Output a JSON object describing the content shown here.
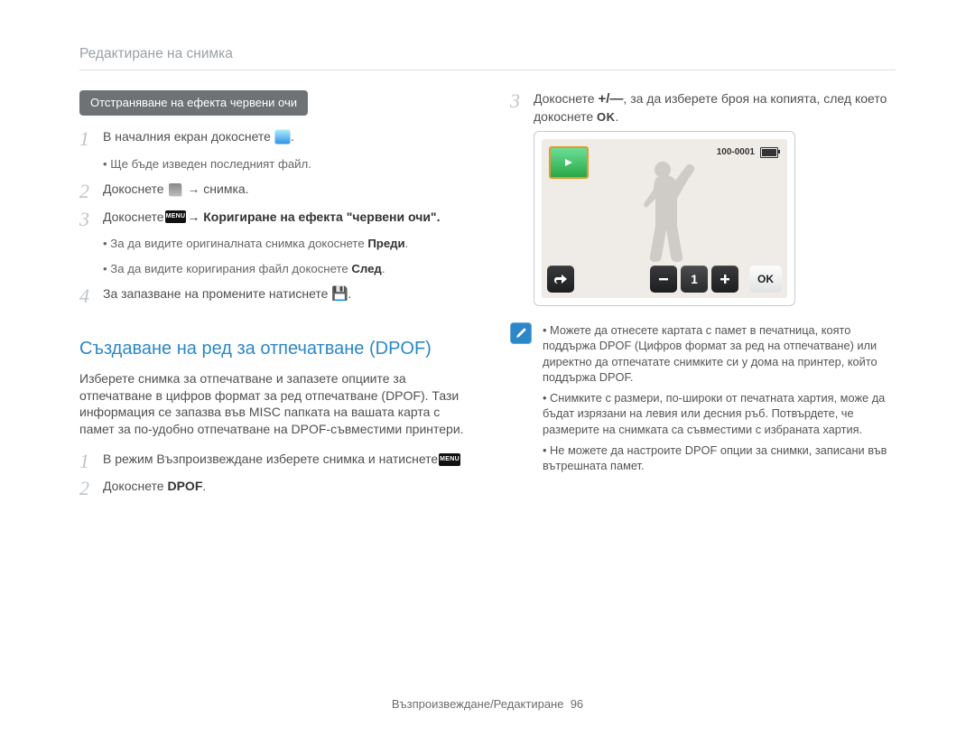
{
  "breadcrumb": "Редактиране на снимка",
  "left": {
    "pill": "Отстраняване на ефекта червени очи",
    "steps": [
      {
        "num": "1",
        "text": "В началния екран докоснете ",
        "trail_icon": "home-icon",
        "after": "."
      },
      {
        "num": "",
        "sub": "Ще бъде изведен последният файл."
      },
      {
        "num": "2",
        "text": "Докоснете ",
        "icon": "duplicate-icon",
        "after": " → снимка."
      },
      {
        "num": "3",
        "pre": "Докоснете ",
        "icon": "menu-icon",
        "after_strong": " → Коригиране на ефекта \"червени очи\"."
      },
      {
        "num": "",
        "sub_pre": "За да видите оригиналната снимка докоснете ",
        "sub_bold": "Преди",
        "sub_after": "."
      },
      {
        "num": "",
        "sub_pre": "За да видите коригирания файл докоснете ",
        "sub_bold": "След",
        "sub_after": "."
      },
      {
        "num": "4",
        "text": "За запазване на промените натиснете ",
        "icon": "save-icon",
        "after": "."
      }
    ],
    "h2": "Създаване на ред за отпечатване (DPOF)",
    "intro": "Изберете снимка за отпечатване и запазете опциите за отпечатване в цифров формат за ред отпечатване (DPOF). Тази информация се запазва във MISC папката на вашата карта с памет за по-удобно отпечатване на DPOF-съвместими принтери.",
    "steps2": [
      {
        "num": "1",
        "text_pre": "В режим Възпроизвеждане изберете снимка и натиснете ",
        "icon": "menu-icon",
        "after": "."
      },
      {
        "num": "2",
        "text_pre": "Докоснете ",
        "bold": "DPOF",
        "after": "."
      }
    ]
  },
  "right": {
    "step3": {
      "num": "3",
      "pre": "Докоснете ",
      "pm": "+/—",
      "mid": ", за да изберете броя на копията, след което докоснете ",
      "ok": "OK",
      "after": "."
    },
    "lcd": {
      "file_counter": "100-0001",
      "count": "1",
      "ok": "OK"
    },
    "note_icon_glyph": "✎",
    "notes": [
      "Можете да отнесете картата с памет в печатница, която поддържа DPOF (Цифров формат за ред на отпечатване) или директно да отпечатате снимките си у дома на принтер, който поддържа DPOF.",
      "Снимките с размери, по-широки от печатната хартия, може да бъдат изрязани на левия или десния ръб. Потвърдете, че размерите на снимката са съвместими с избраната хартия.",
      "Не можете да настроите DPOF опции за снимки, записани във вътрешната памет."
    ]
  },
  "footer": {
    "section": "Възпроизвеждане/Редактиране",
    "page": "96"
  }
}
